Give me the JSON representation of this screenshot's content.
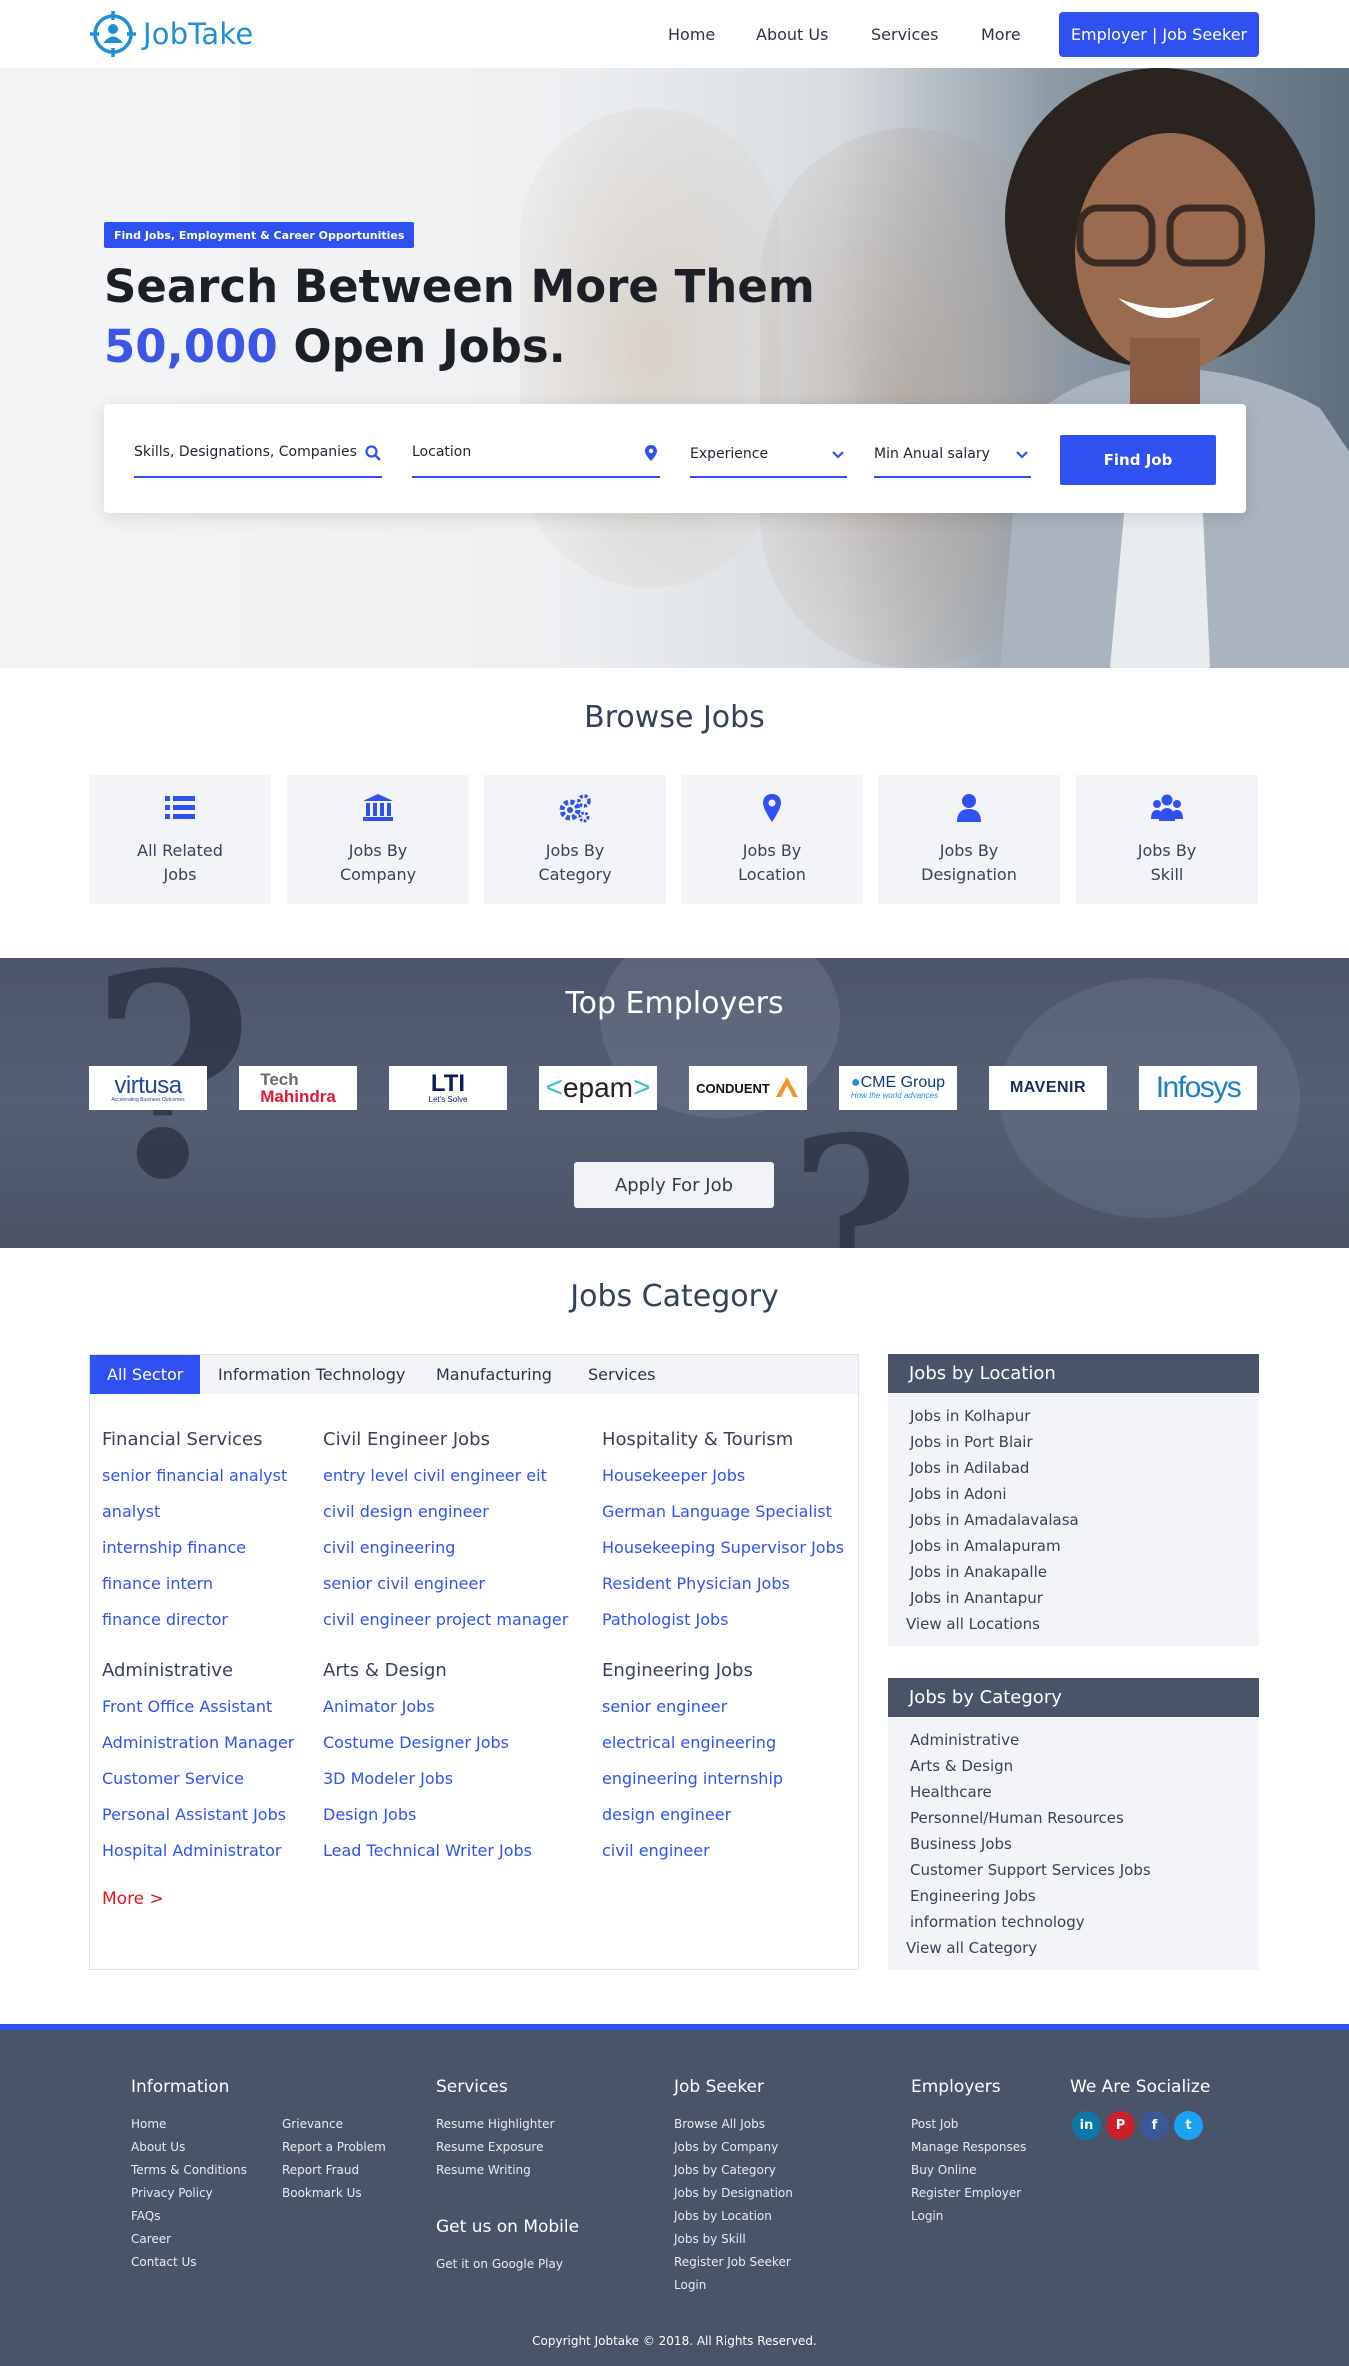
{
  "header": {
    "logo_text": "JobTake",
    "nav": [
      "Home",
      "About Us",
      "Services",
      "More"
    ],
    "cta": "Employer | Job Seeker"
  },
  "hero": {
    "tag": "Find Jobs, Employment & Career Opportunities",
    "line1": "Search Between More Them",
    "line2_accent": "50,000",
    "line2_rest": " Open Jobs.",
    "search": {
      "skills_placeholder": "Skills, Designations, Companies",
      "location_placeholder": "Location",
      "experience_label": "Experience",
      "salary_label": "Min Anual salary",
      "button": "Find Job"
    }
  },
  "browse": {
    "title": "Browse Jobs",
    "cards": [
      {
        "icon": "list-icon",
        "line1": "All  Related",
        "line2": "Jobs"
      },
      {
        "icon": "bank-icon",
        "line1": "Jobs By",
        "line2": "Company"
      },
      {
        "icon": "gears-icon",
        "line1": "Jobs By",
        "line2": "Category"
      },
      {
        "icon": "map-pin-icon",
        "line1": "Jobs By",
        "line2": "Location"
      },
      {
        "icon": "user-icon",
        "line1": "Jobs By",
        "line2": "Designation"
      },
      {
        "icon": "users-icon",
        "line1": "Jobs By",
        "line2": "Skill"
      }
    ]
  },
  "employers": {
    "title": "Top Employers",
    "logos": [
      "virtusa",
      "Accelerating Business Outcomes",
      "Tech",
      "Mahindra",
      "LTI",
      "Let's Solve",
      "epam",
      "CONDUENT",
      "CME Group",
      "How the world advances",
      "MAVENIR",
      "Infosys"
    ],
    "apply_button": "Apply For Job"
  },
  "category": {
    "title": "Jobs Category",
    "tabs": [
      "All Sector",
      "Information Technology",
      "Manufacturing",
      "Services"
    ],
    "groups": [
      {
        "head": "Financial Services",
        "links": [
          "senior financial analyst",
          "analyst",
          "internship finance",
          "finance intern",
          "finance director"
        ]
      },
      {
        "head": "Civil Engineer Jobs",
        "links": [
          "entry level civil engineer eit",
          "civil design engineer",
          "civil engineering",
          "senior civil engineer",
          "civil engineer project manager"
        ]
      },
      {
        "head": "Hospitality & Tourism",
        "links": [
          "Housekeeper Jobs",
          "German Language Specialist",
          "Housekeeping Supervisor Jobs",
          "Resident Physician Jobs",
          "Pathologist Jobs"
        ]
      },
      {
        "head": "Administrative",
        "links": [
          "Front Office Assistant",
          "Administration Manager",
          "Customer Service",
          "Personal Assistant Jobs",
          "Hospital Administrator"
        ]
      },
      {
        "head": "Arts & Design",
        "links": [
          "Animator Jobs",
          "Costume Designer Jobs",
          "3D Modeler Jobs",
          "Design Jobs",
          "Lead Technical Writer Jobs"
        ]
      },
      {
        "head": "Engineering Jobs",
        "links": [
          "senior engineer",
          "electrical engineering",
          "engineering internship",
          "design engineer",
          "civil engineer"
        ]
      }
    ],
    "more": "More >"
  },
  "side_location": {
    "title": "Jobs by Location",
    "items": [
      "Jobs in Kolhapur",
      "Jobs in Port Blair",
      "Jobs in Adilabad",
      "Jobs in Adoni",
      "Jobs in Amadalavalasa",
      "Jobs in Amalapuram",
      "Jobs in Anakapalle",
      "Jobs in Anantapur"
    ],
    "view_all": "View all Locations"
  },
  "side_category": {
    "title": "Jobs by Category",
    "items": [
      "Administrative",
      "Arts & Design",
      "Healthcare",
      "Personnel/Human Resources",
      "Business Jobs",
      "Customer Support Services Jobs",
      "Engineering Jobs",
      "information technology"
    ],
    "view_all": "View all Category"
  },
  "footer": {
    "information": {
      "title": "Information",
      "col1": [
        "Home",
        "About Us",
        "Terms & Conditions",
        "Privacy Policy",
        "FAQs",
        "Career",
        "Contact Us"
      ],
      "col2": [
        "Grievance",
        "Report a Problem",
        "Report Fraud",
        "Bookmark Us"
      ]
    },
    "services": {
      "title": "Services",
      "links": [
        "Resume Highlighter",
        "Resume Exposure",
        "Resume Writing"
      ]
    },
    "mobile": {
      "title": "Get us on Mobile",
      "link": "Get it on Google Play"
    },
    "job_seeker": {
      "title": "Job Seeker",
      "links": [
        "Browse All Jobs",
        "Jobs by Company",
        "Jobs by Category",
        "Jobs by Designation",
        "Jobs by Location",
        "Jobs by Skill",
        "Register Job Seeker",
        "Login"
      ]
    },
    "employers": {
      "title": "Employers",
      "links": [
        "Post Job",
        "Manage Responses",
        "Buy Online",
        "Register Employer",
        "Login"
      ]
    },
    "social": {
      "title": "We Are Socialize",
      "icons": [
        "in",
        "P",
        "f",
        "t"
      ],
      "colors": [
        "#0e76a8",
        "#cb2027",
        "#3b5998",
        "#1da1f2"
      ]
    },
    "copyright": "Copyright Jobtake © 2018. All Rights Reserved."
  },
  "colors": {
    "primary": "#3051f2",
    "logo": "#1d8fd6",
    "footer_bg": "#4a5468",
    "more_link": "#e0151d"
  }
}
